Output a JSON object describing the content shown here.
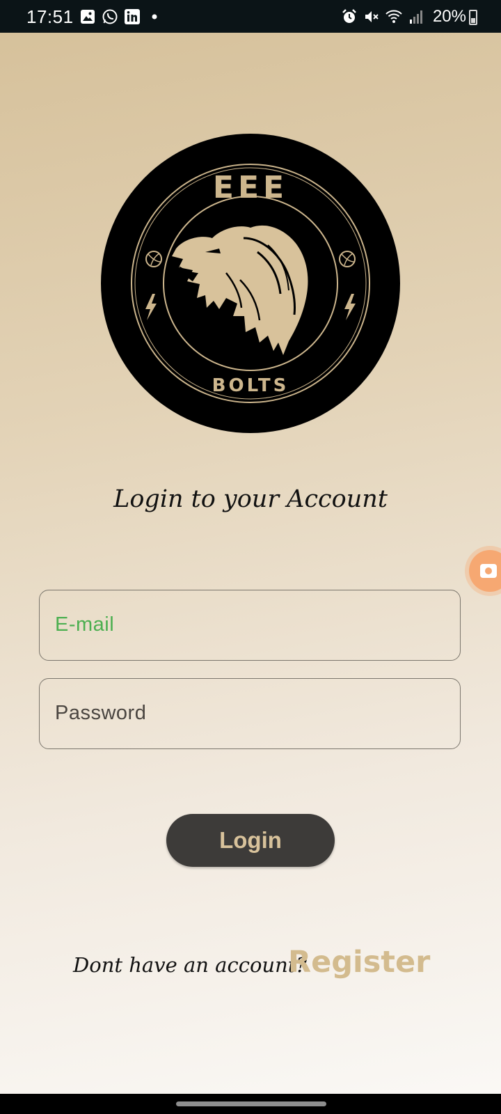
{
  "status_bar": {
    "time": "17:51",
    "battery": "20%",
    "left_icons": [
      "gallery-icon",
      "whatsapp-icon",
      "linkedin-icon",
      "dot-icon"
    ],
    "right_icons": [
      "alarm-icon",
      "mute-icon",
      "wifi-icon",
      "signal-icon",
      "battery-icon"
    ]
  },
  "logo": {
    "top_text": "EEE",
    "bottom_text": "BOLTS",
    "emblem": "lion-icon"
  },
  "login": {
    "title": "Login to your Account",
    "email_placeholder": "E-mail",
    "password_placeholder": "Password",
    "button_label": "Login"
  },
  "register": {
    "prompt": "Dont have an account?",
    "link_label": "Register"
  },
  "colors": {
    "accent": "#d3bb8e",
    "button_bg": "#3d3b39",
    "email_placeholder": "#4caf50",
    "float_button": "#f6a872"
  }
}
